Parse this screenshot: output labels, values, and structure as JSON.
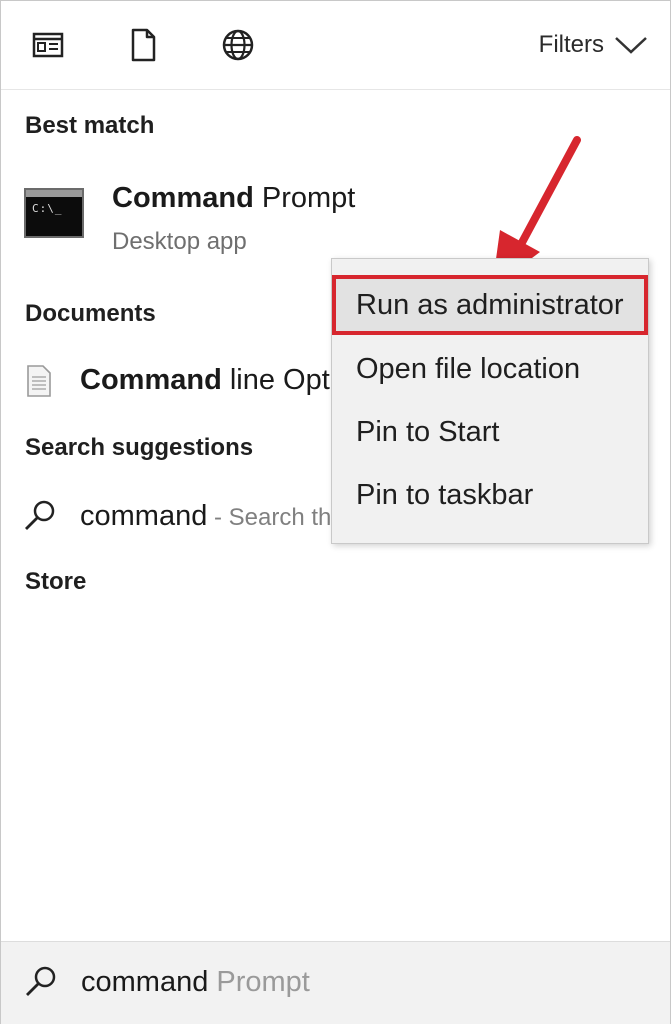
{
  "topbar": {
    "icons": [
      "apps-icon",
      "document-icon",
      "globe-icon"
    ],
    "filters_label": "Filters"
  },
  "best_match": {
    "title": "Best match",
    "app_name_bold": "Command",
    "app_name_rest": " Prompt",
    "app_subtitle": "Desktop app",
    "app_icon_text": "C:\\_"
  },
  "documents": {
    "title": "Documents",
    "item_bold": "Command",
    "item_rest": " line Opt"
  },
  "search_suggestions": {
    "title": "Search suggestions",
    "query": "command",
    "hint": " - Search th"
  },
  "store": {
    "title": "Store"
  },
  "context_menu": {
    "items": [
      "Run as administrator",
      "Open file location",
      "Pin to Start",
      "Pin to taskbar"
    ],
    "highlighted_index": 0
  },
  "search_box": {
    "typed": "command",
    "suggestion": " Prompt"
  },
  "colors": {
    "highlight_border": "#d7262e",
    "arrow": "#d7262e"
  }
}
